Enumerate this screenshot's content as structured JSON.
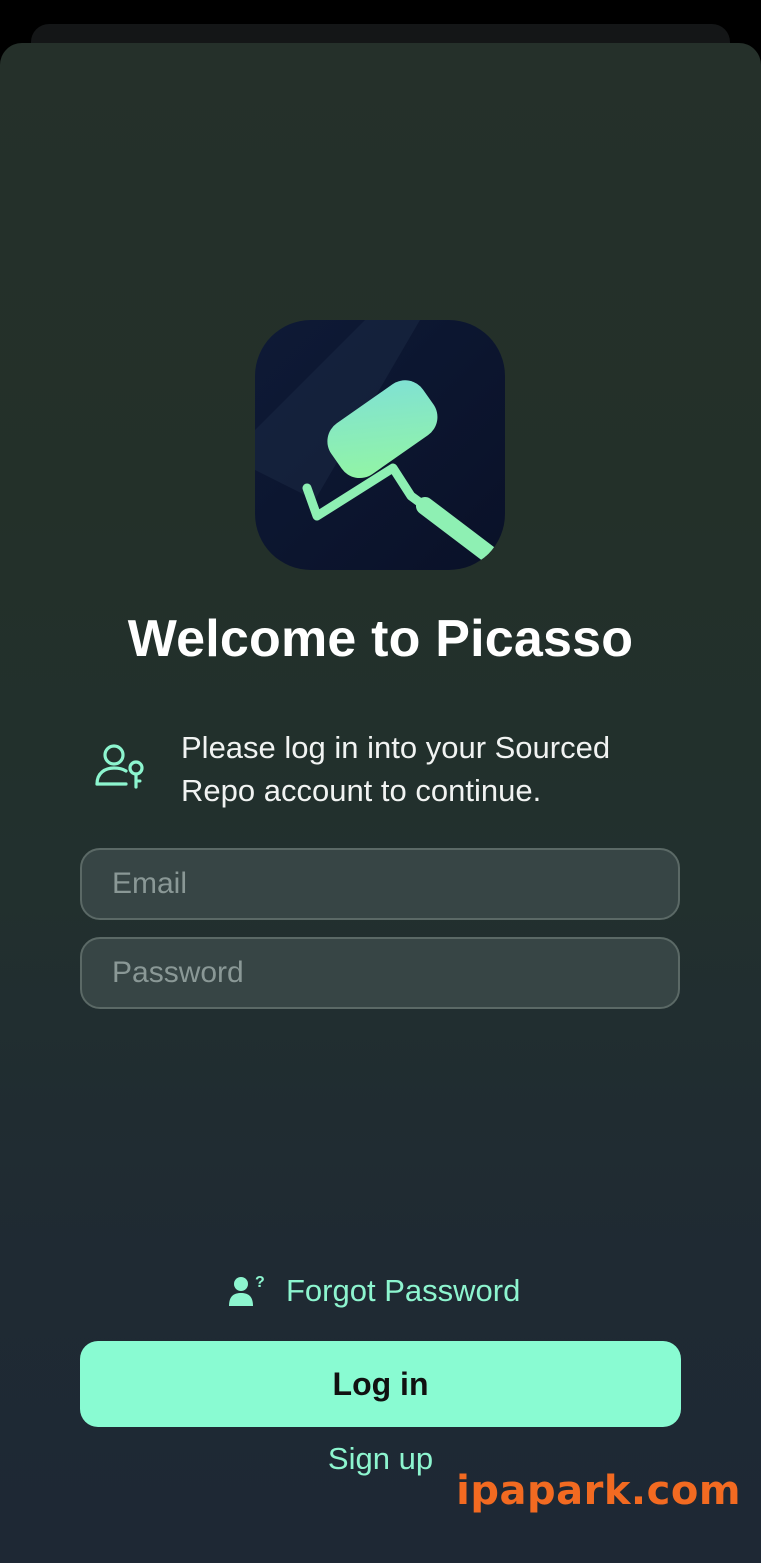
{
  "welcome": {
    "title": "Welcome to Picasso"
  },
  "notice": {
    "icon": "user-key-icon",
    "text": "Please log in into your Sourced Repo account to continue."
  },
  "form": {
    "email_placeholder": "Email",
    "password_placeholder": "Password"
  },
  "actions": {
    "forgot_icon": "user-question-icon",
    "forgot_label": "Forgot Password",
    "login_label": "Log in",
    "signup_label": "Sign up"
  },
  "watermark": "ipapark.com",
  "colors": {
    "accent": "#89fbd2",
    "accent_text": "#8df5cf",
    "watermark": "#f26a21"
  }
}
